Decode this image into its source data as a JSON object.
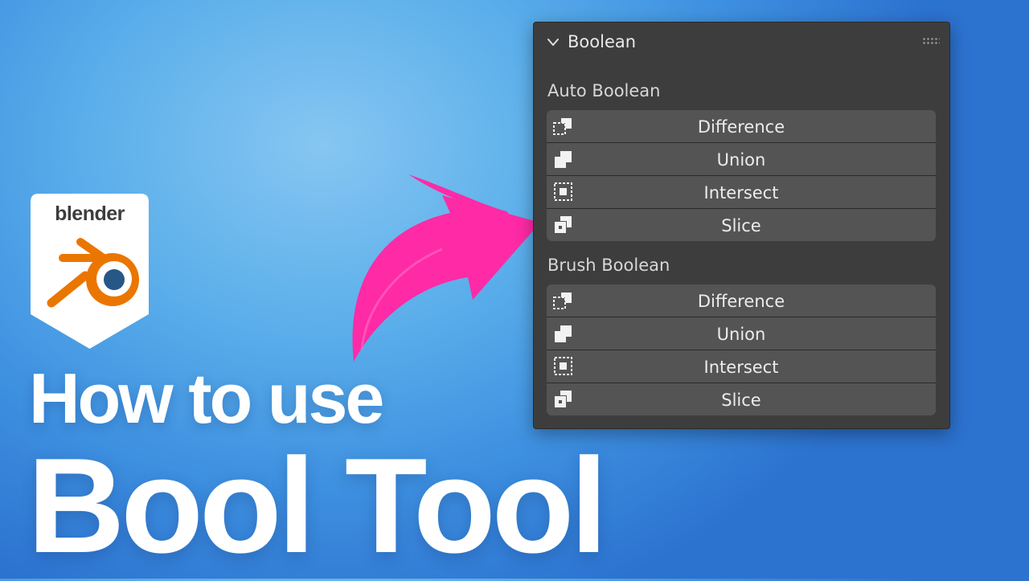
{
  "logo": {
    "text": "blender",
    "colors": {
      "shield": "#ffffff",
      "orange": "#ea7600",
      "blue": "#265787",
      "text": "#3d3d3d"
    }
  },
  "headline": {
    "line1": "How to use",
    "line2": "Bool Tool"
  },
  "arrow": {
    "color": "#ff2aa6"
  },
  "panel": {
    "title": "Boolean",
    "sections": [
      {
        "label": "Auto Boolean",
        "buttons": [
          {
            "label": "Difference",
            "icon": "boolean-difference-icon"
          },
          {
            "label": "Union",
            "icon": "boolean-union-icon"
          },
          {
            "label": "Intersect",
            "icon": "boolean-intersect-icon"
          },
          {
            "label": "Slice",
            "icon": "boolean-slice-icon"
          }
        ]
      },
      {
        "label": "Brush Boolean",
        "buttons": [
          {
            "label": "Difference",
            "icon": "boolean-difference-icon"
          },
          {
            "label": "Union",
            "icon": "boolean-union-icon"
          },
          {
            "label": "Intersect",
            "icon": "boolean-intersect-icon"
          },
          {
            "label": "Slice",
            "icon": "boolean-slice-icon"
          }
        ]
      }
    ]
  }
}
